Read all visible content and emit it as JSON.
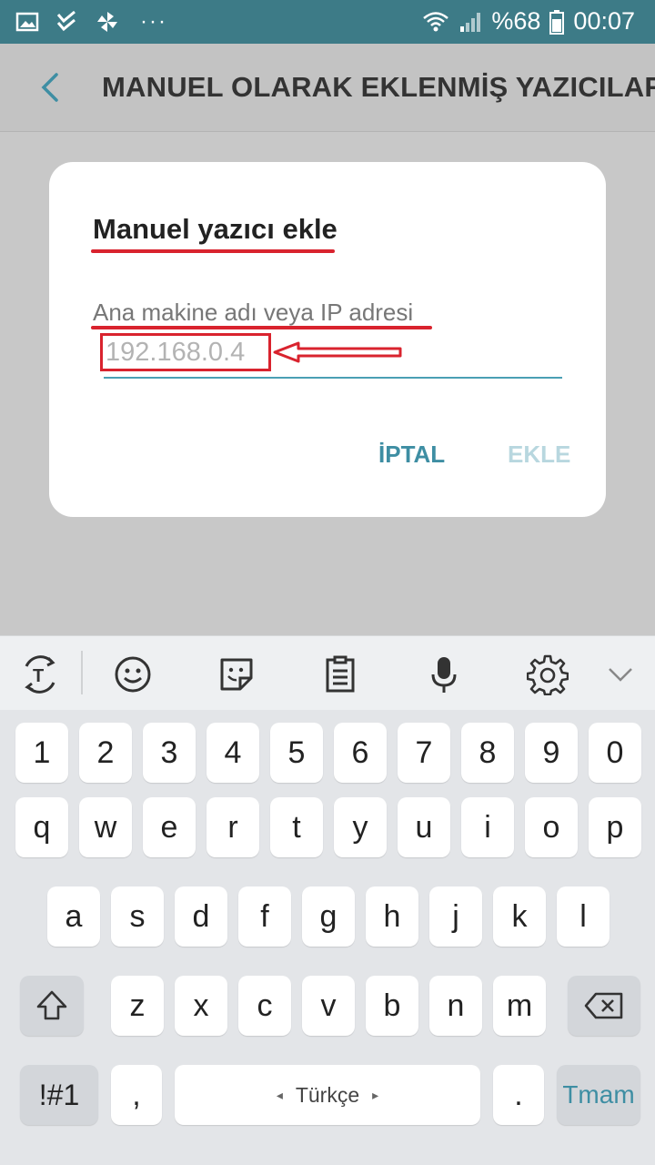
{
  "status_bar": {
    "battery": "%68",
    "time": "00:07",
    "more": "···"
  },
  "app_bar": {
    "title": "MANUEL OLARAK EKLENMİŞ YAZICILAR"
  },
  "dialog": {
    "title": "Manuel yazıcı ekle",
    "field_label": "Ana makine adı veya IP adresi",
    "field_value": "",
    "field_placeholder": "192.168.0.4",
    "cancel_label": "İPTAL",
    "add_label": "EKLE"
  },
  "keyboard": {
    "row_numbers": [
      "1",
      "2",
      "3",
      "4",
      "5",
      "6",
      "7",
      "8",
      "9",
      "0"
    ],
    "row_q": [
      "q",
      "w",
      "e",
      "r",
      "t",
      "y",
      "u",
      "i",
      "o",
      "p"
    ],
    "row_a": [
      "a",
      "s",
      "d",
      "f",
      "g",
      "h",
      "j",
      "k",
      "l"
    ],
    "row_z": [
      "z",
      "x",
      "c",
      "v",
      "b",
      "n",
      "m"
    ],
    "symbols_label": "!#1",
    "comma_label": ",",
    "space_label": "Türkçe",
    "period_label": ".",
    "done_label": "Tmam"
  },
  "colors": {
    "status_bar": "#3d7b87",
    "accent": "#3e8ea3",
    "annotation_red": "#d9232e"
  }
}
